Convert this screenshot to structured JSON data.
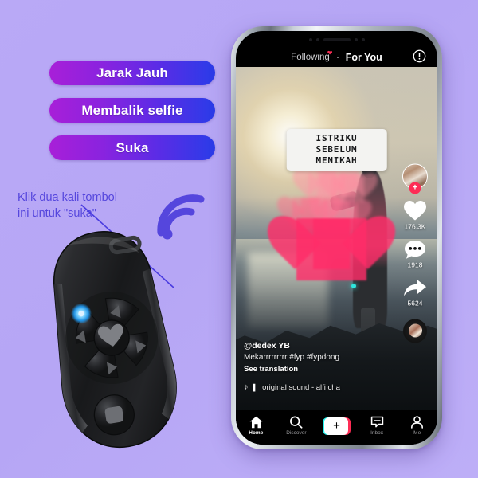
{
  "background": {
    "color": "#b9a9f6"
  },
  "promo": {
    "accent_start": "#a81fd8",
    "accent_end": "#2a3ce8",
    "pills": [
      {
        "label": "Jarak Jauh"
      },
      {
        "label": "Membalik selfie"
      },
      {
        "label": "Suka"
      }
    ]
  },
  "annotation": {
    "color": "#5546dd",
    "line1": "Klik dua kali tombol",
    "line2": "ini untuk \"suka\"",
    "icon": "wifi-signal-icon"
  },
  "remote": {
    "name": "bluetooth-shutter-remote",
    "center_button_icon": "heart-icon",
    "dpad_icons": [
      "triangle-up-icon",
      "triangle-left-icon",
      "triangle-right-icon",
      "triangle-down-icon"
    ],
    "bottom_button_icon": "shutter-square-icon",
    "led_color": "#2aa8ff"
  },
  "phone": {
    "app": {
      "top_tabs": [
        {
          "label": "Following",
          "active": false,
          "badge": "heart-dot"
        },
        {
          "label": "For You",
          "active": true
        }
      ],
      "info_icon": "exclamation-circle-icon",
      "video": {
        "caption_line1": "ISTRIKU SEBELUM",
        "caption_line2": "MENIKAH",
        "username": "@dedex YB",
        "description": "Mekarrrrrrrrr #fyp #fypdong",
        "translation_label": "See translation",
        "music_icon": "music-note-icon",
        "music_title": "original sound - alfi cha"
      },
      "rail": [
        {
          "name": "avatar",
          "icon": "avatar-image",
          "badge": "+",
          "count": ""
        },
        {
          "name": "like",
          "icon": "heart-icon",
          "count": "176.3K"
        },
        {
          "name": "comment",
          "icon": "comment-bubble-icon",
          "count": "1918"
        },
        {
          "name": "share",
          "icon": "share-arrow-icon",
          "count": "5624"
        },
        {
          "name": "sound-disc",
          "icon": "vinyl-record-icon",
          "count": ""
        }
      ],
      "nav": [
        {
          "label": "Home",
          "icon": "home-icon",
          "active": true
        },
        {
          "label": "Discover",
          "icon": "search-icon",
          "active": false
        },
        {
          "label": "",
          "icon": "plus-create-icon",
          "active": false,
          "symbol": "+"
        },
        {
          "label": "Inbox",
          "icon": "inbox-message-icon",
          "active": false
        },
        {
          "label": "Me",
          "icon": "person-icon",
          "active": false
        }
      ]
    }
  }
}
